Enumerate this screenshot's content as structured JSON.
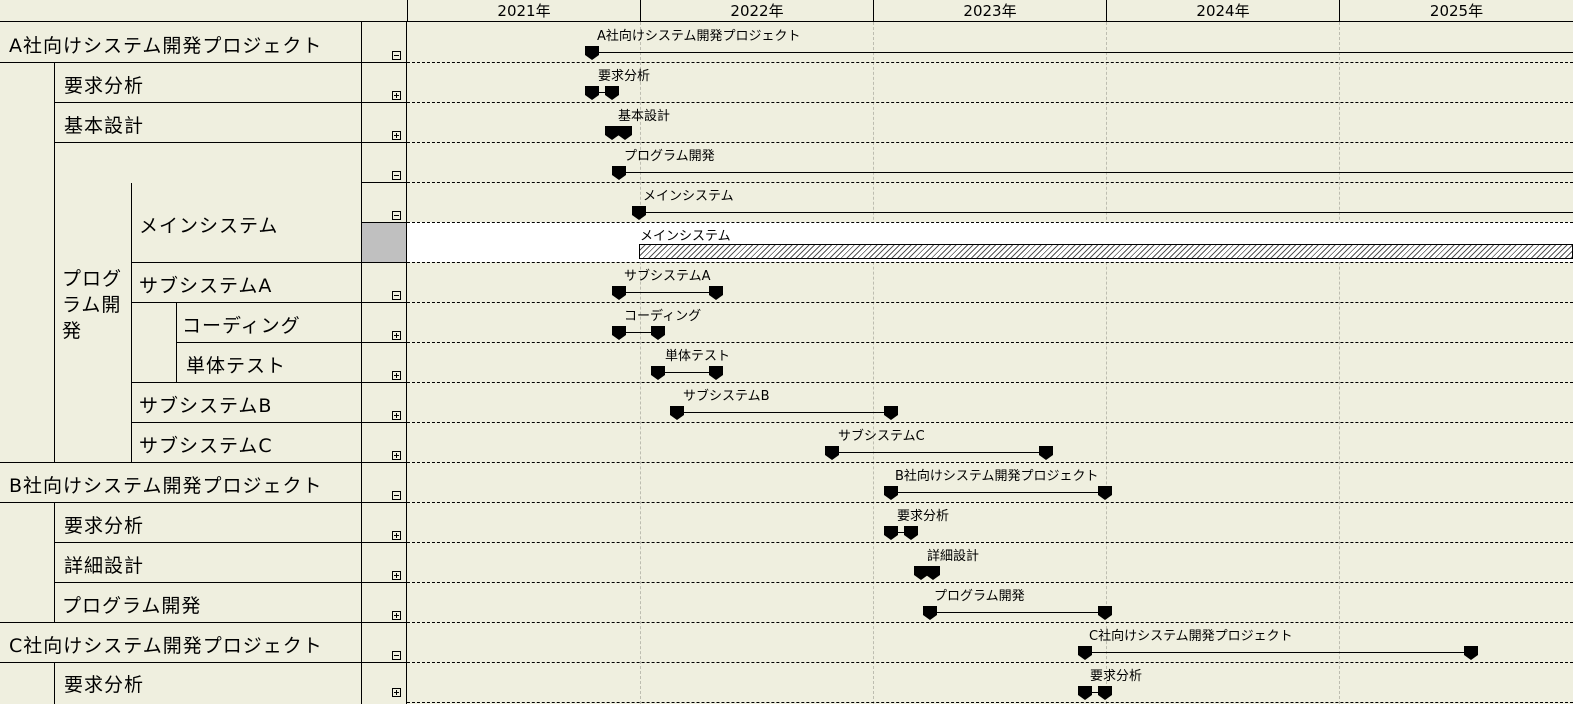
{
  "years": [
    "2021年",
    "2022年",
    "2023年",
    "2024年",
    "2025年"
  ],
  "tree": {
    "a_project": "A社向けシステム開発プロジェクト",
    "a_req": "要求分析",
    "a_basic": "基本設計",
    "a_prog": "プログラム開発",
    "a_main": "メインシステム",
    "a_subA": "サブシステムA",
    "a_coding": "コーディング",
    "a_unit": "単体テスト",
    "a_subB": "サブシステムB",
    "a_subC": "サブシステムC",
    "b_project": "B社向けシステム開発プロジェクト",
    "b_req": "要求分析",
    "b_detail": "詳細設計",
    "b_prog": "プログラム開発",
    "c_project": "C社向けシステム開発プロジェクト",
    "c_req": "要求分析"
  },
  "bars": {
    "a_project": "A社向けシステム開発プロジェクト",
    "a_req": "要求分析",
    "a_basic": "基本設計",
    "a_prog": "プログラム開発",
    "a_main": "メインシステム",
    "a_main_edit": "メインシステム",
    "a_subA": "サブシステムA",
    "a_coding": "コーディング",
    "a_unit": "単体テスト",
    "a_subB": "サブシステムB",
    "a_subC": "サブシステムC",
    "b_project": "B社向けシステム開発プロジェクト",
    "b_req": "要求分析",
    "b_detail": "詳細設計",
    "b_prog": "プログラム開発",
    "c_project": "C社向けシステム開発プロジェクト",
    "c_req": "要求分析"
  }
}
